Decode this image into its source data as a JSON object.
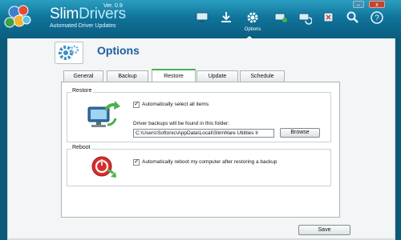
{
  "app": {
    "name_part1": "Slim",
    "name_part2": "Drivers",
    "version": "Ver. 0.9",
    "subtitle": "Automated Driver Updates"
  },
  "window": {
    "minimize": "–",
    "close": "x"
  },
  "nav": [
    {
      "id": "scan",
      "icon": "monitor-icon",
      "label": ""
    },
    {
      "id": "download",
      "icon": "download-icon",
      "label": ""
    },
    {
      "id": "options",
      "icon": "gear-icon",
      "label": "Options"
    },
    {
      "id": "backup",
      "icon": "backup-icon",
      "label": ""
    },
    {
      "id": "restore",
      "icon": "restore-icon",
      "label": ""
    },
    {
      "id": "uninstall",
      "icon": "uninstall-icon",
      "label": ""
    },
    {
      "id": "search",
      "icon": "search-icon",
      "label": ""
    },
    {
      "id": "help",
      "icon": "help-icon",
      "label": ""
    }
  ],
  "page": {
    "title": "Options"
  },
  "tabs": [
    {
      "label": "General",
      "active": false
    },
    {
      "label": "Backup",
      "active": false
    },
    {
      "label": "Restore",
      "active": true
    },
    {
      "label": "Update",
      "active": false
    },
    {
      "label": "Schedule",
      "active": false
    }
  ],
  "restore": {
    "title": "Restore",
    "auto_select_label": "Automatically select all items",
    "auto_select_checked": true,
    "folder_label": "Driver backups will be found in this folder:",
    "folder_value": "C:\\Users\\Softonic\\AppData\\Local\\SlimWare Utilities Ir",
    "browse_label": "Browse"
  },
  "reboot": {
    "title": "Reboot",
    "auto_reboot_label": "Automatically reboot my computer after restoring a backup",
    "auto_reboot_checked": true
  },
  "footer": {
    "save_label": "Save"
  },
  "colors": {
    "header": "#10739a",
    "accent_tab": "#49b14a",
    "title": "#1b5e9e",
    "panel": "#f3f5f6"
  }
}
